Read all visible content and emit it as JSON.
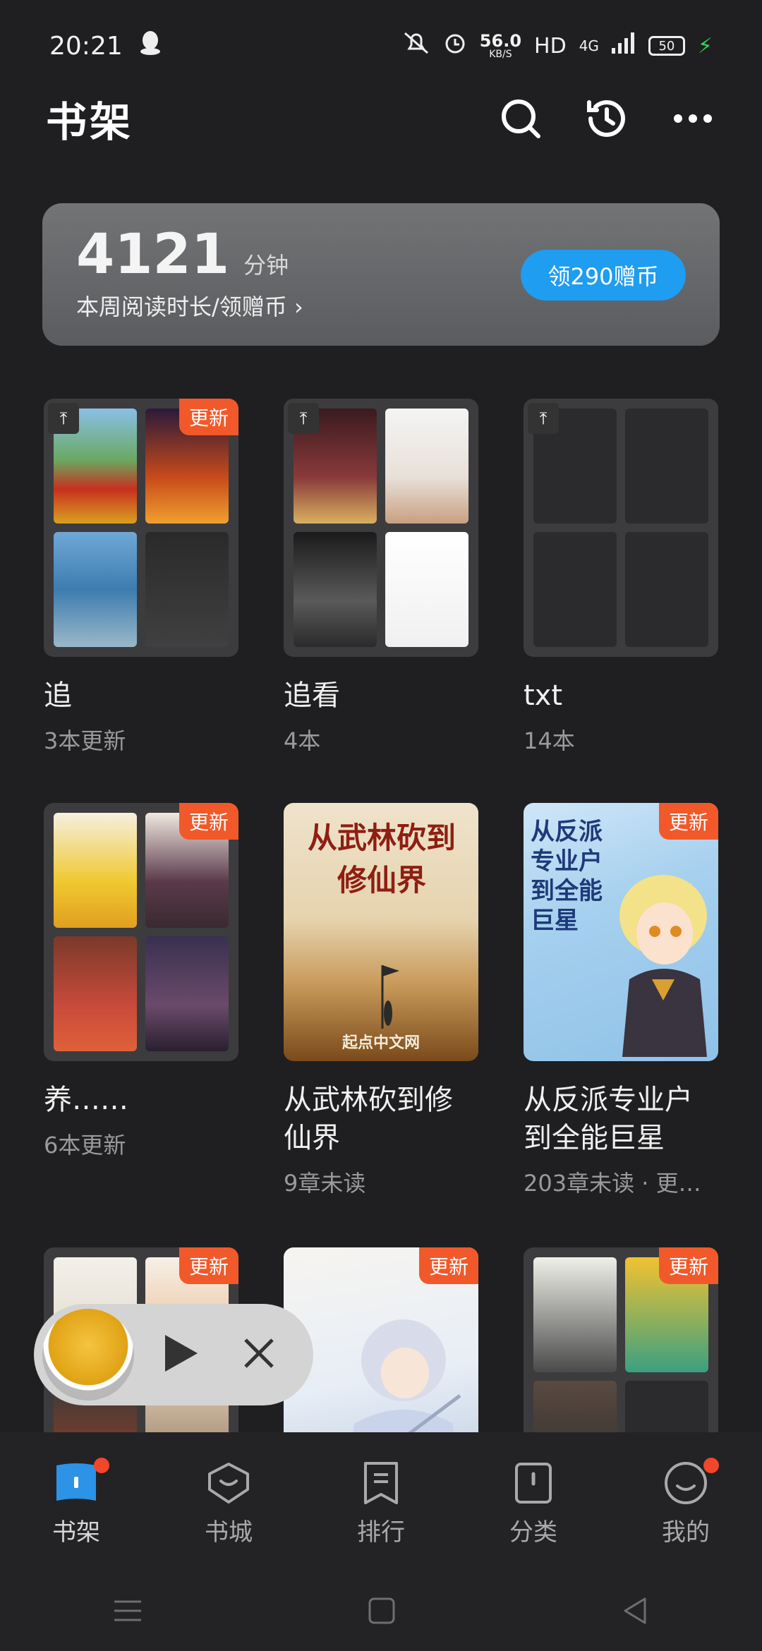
{
  "status": {
    "time": "20:21",
    "speed_value": "56.0",
    "speed_unit": "KB/S",
    "hd": "HD",
    "network": "4G",
    "battery": "50"
  },
  "header": {
    "title": "书架"
  },
  "reading": {
    "minutes": "4121",
    "unit": "分钟",
    "subtitle": "本周阅读时长/领赠币 ›",
    "claim_label": "领290赠币"
  },
  "items": [
    {
      "title": "追",
      "sub": "3本更新",
      "badge": "更新"
    },
    {
      "title": "追看",
      "sub": "4本"
    },
    {
      "title": "txt",
      "sub": "14本"
    },
    {
      "title": "养……",
      "sub": "6本更新",
      "badge": "更新"
    },
    {
      "title": "从武林砍到修仙界",
      "sub": "9章未读",
      "cover_text": "从武林砍到修仙界",
      "cover_brand": "起点中文网"
    },
    {
      "title": "从反派专业户到全能巨星",
      "sub": "203章未读 · 更…",
      "badge": "更新",
      "cover_text": "从反派专业户到全能巨星"
    },
    {
      "badge": "更新"
    },
    {
      "badge": "更新"
    },
    {
      "badge": "更新"
    }
  ],
  "tabs": [
    {
      "label": "书架"
    },
    {
      "label": "书城"
    },
    {
      "label": "排行"
    },
    {
      "label": "分类"
    },
    {
      "label": "我的"
    }
  ],
  "colors": {
    "accent_blue": "#1e9df1",
    "badge_orange": "#f1592a",
    "notify_red": "#f1472b"
  }
}
